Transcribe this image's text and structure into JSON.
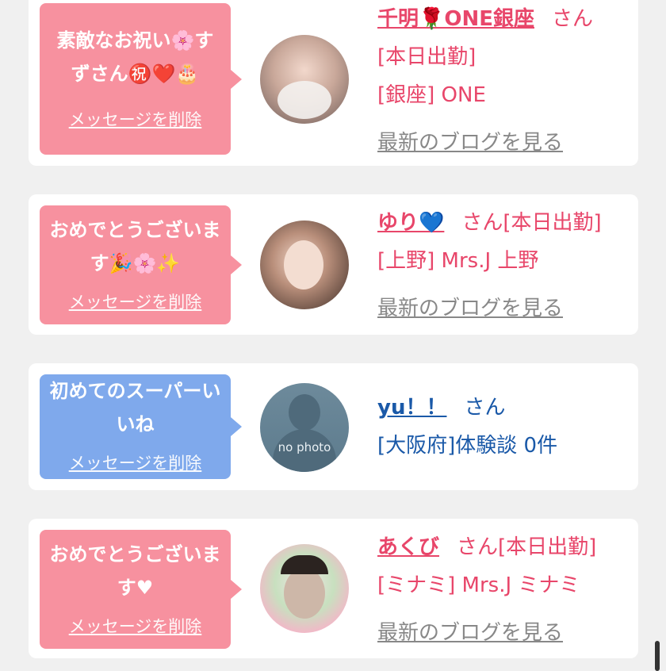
{
  "messages": [
    {
      "text": "素敵なお祝い🌸すずさん㊗️❤️🎂",
      "delete_label": "メッセージを削除",
      "name": "千明🌹ONE銀座",
      "san": "さん",
      "line1": "[本日出勤]",
      "line2": "[銀座] ONE",
      "blog": "最新のブログを見る",
      "color": "#f7919f"
    },
    {
      "text": "おめでとうございます🎉🌸✨",
      "delete_label": "メッセージを削除",
      "name": "ゆり💙",
      "san": "さん[本日出勤]",
      "line1": "[上野] Mrs.J 上野",
      "blog": "最新のブログを見る",
      "color": "#f7919f"
    },
    {
      "text": "初めてのスーパーいいね",
      "delete_label": "メッセージを削除",
      "name": "yu！！",
      "san": "さん",
      "line1": "[大阪府]体験談 0件",
      "avatar_text": "no photo",
      "color": "#7fa9ec"
    },
    {
      "text": "おめでとうございます♥",
      "delete_label": "メッセージを削除",
      "name": "あくび",
      "san": "さん[本日出勤]",
      "line1": "[ミナミ] Mrs.J ミナミ",
      "blog": "最新のブログを見る",
      "color": "#f7919f"
    }
  ]
}
